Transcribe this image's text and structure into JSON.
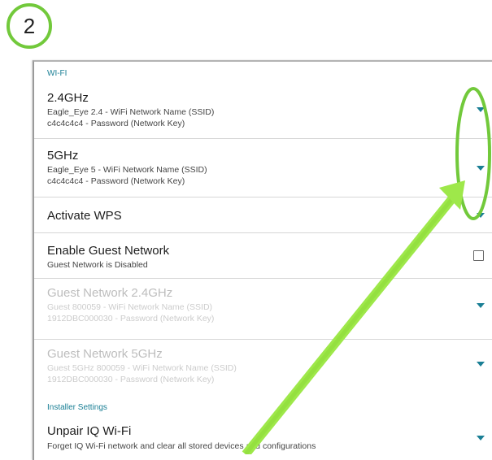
{
  "step_number": "2",
  "sections": {
    "wifi_label": "WI-FI",
    "installer_label": "Installer Settings"
  },
  "rows": {
    "ghz24": {
      "title": "2.4GHz",
      "line1": "Eagle_Eye 2.4 - WiFi Network Name (SSID)",
      "line2": "c4c4c4c4 - Password (Network Key)"
    },
    "ghz5": {
      "title": "5GHz",
      "line1": "Eagle_Eye 5 - WiFi Network Name (SSID)",
      "line2": "c4c4c4c4 - Password (Network Key)"
    },
    "wps": {
      "title": "Activate WPS"
    },
    "guest": {
      "title": "Enable Guest Network",
      "line1": "Guest Network is Disabled",
      "checked": false
    },
    "guest24": {
      "title": "Guest Network 2.4GHz",
      "line1": "Guest 800059 - WiFi Network Name (SSID)",
      "line2": "1912DBC000030 - Password (Network Key)"
    },
    "guest5": {
      "title": "Guest Network 5GHz",
      "line1": "Guest 5GHz 800059 - WiFi Network Name (SSID)",
      "line2": "1912DBC000030 - Password (Network Key)"
    },
    "unpair": {
      "title": "Unpair IQ Wi-Fi",
      "line1": "Forget IQ Wi-Fi network and clear all stored devices and configurations"
    }
  },
  "colors": {
    "accent_teal": "#1a7f95",
    "highlight_green": "#72c93b"
  },
  "icons": {
    "dropdown": "chevron-down-icon",
    "checkbox": "checkbox-icon"
  }
}
